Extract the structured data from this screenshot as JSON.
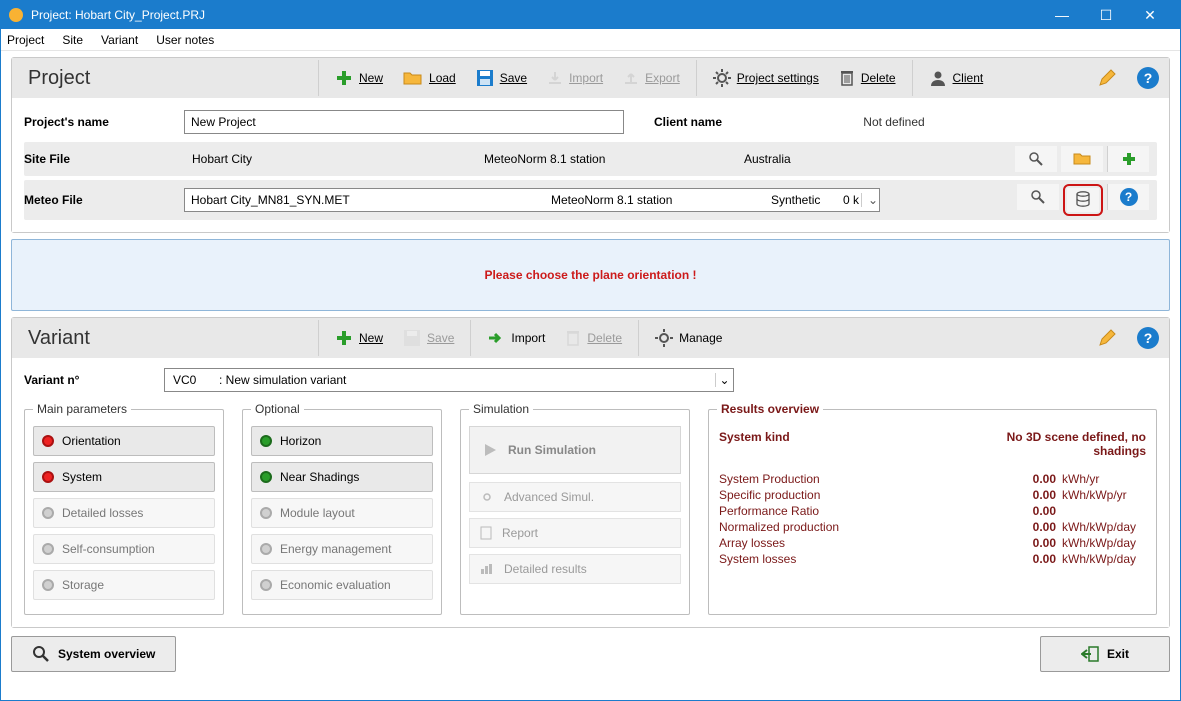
{
  "window": {
    "title": "Project:  Hobart City_Project.PRJ"
  },
  "menu": {
    "project": "Project",
    "site": "Site",
    "variant": "Variant",
    "user_notes": "User notes"
  },
  "project_panel": {
    "title": "Project",
    "tb": {
      "new": "New",
      "load": "Load",
      "save": "Save",
      "import": "Import",
      "export": "Export",
      "settings": "Project settings",
      "delete": "Delete",
      "client": "Client"
    },
    "name_label": "Project's name",
    "name_value": "New Project",
    "client_label": "Client name",
    "client_value": "Not defined",
    "site_label": "Site File",
    "site_name": "Hobart City",
    "site_source": "MeteoNorm 8.1 station",
    "site_country": "Australia",
    "meteo_label": "Meteo File",
    "meteo_file": "Hobart City_MN81_SYN.MET",
    "meteo_source": "MeteoNorm 8.1 station",
    "meteo_type": "Synthetic",
    "meteo_dist": "0 k"
  },
  "notice": "Please choose the plane orientation !",
  "variant_panel": {
    "title": "Variant",
    "tb": {
      "new": "New",
      "save": "Save",
      "import": "Import",
      "delete": "Delete",
      "manage": "Manage"
    },
    "variant_no_label": "Variant n°",
    "variant_code": "VC0",
    "variant_name": ": New simulation variant",
    "main_legend": "Main parameters",
    "main": {
      "orientation": "Orientation",
      "system": "System",
      "detailed_losses": "Detailed losses",
      "self_consumption": "Self-consumption",
      "storage": "Storage"
    },
    "opt_legend": "Optional",
    "opt": {
      "horizon": "Horizon",
      "near_shadings": "Near Shadings",
      "module_layout": "Module layout",
      "energy_mgmt": "Energy management",
      "economic": "Economic evaluation"
    },
    "sim_legend": "Simulation",
    "sim": {
      "run": "Run Simulation",
      "advanced": "Advanced Simul.",
      "report": "Report",
      "detailed": "Detailed results"
    },
    "results_legend": "Results overview",
    "results_head_left": "System kind",
    "results_head_right": "No 3D scene defined, no shadings",
    "results_rows": [
      {
        "k": "System Production",
        "v": "0.00",
        "u": "kWh/yr"
      },
      {
        "k": "Specific production",
        "v": "0.00",
        "u": "kWh/kWp/yr"
      },
      {
        "k": "Performance Ratio",
        "v": "0.00",
        "u": ""
      },
      {
        "k": "Normalized production",
        "v": "0.00",
        "u": "kWh/kWp/day"
      },
      {
        "k": "Array losses",
        "v": "0.00",
        "u": "kWh/kWp/day"
      },
      {
        "k": "System losses",
        "v": "0.00",
        "u": "kWh/kWp/day"
      }
    ]
  },
  "footer": {
    "overview": "System overview",
    "exit": "Exit"
  }
}
